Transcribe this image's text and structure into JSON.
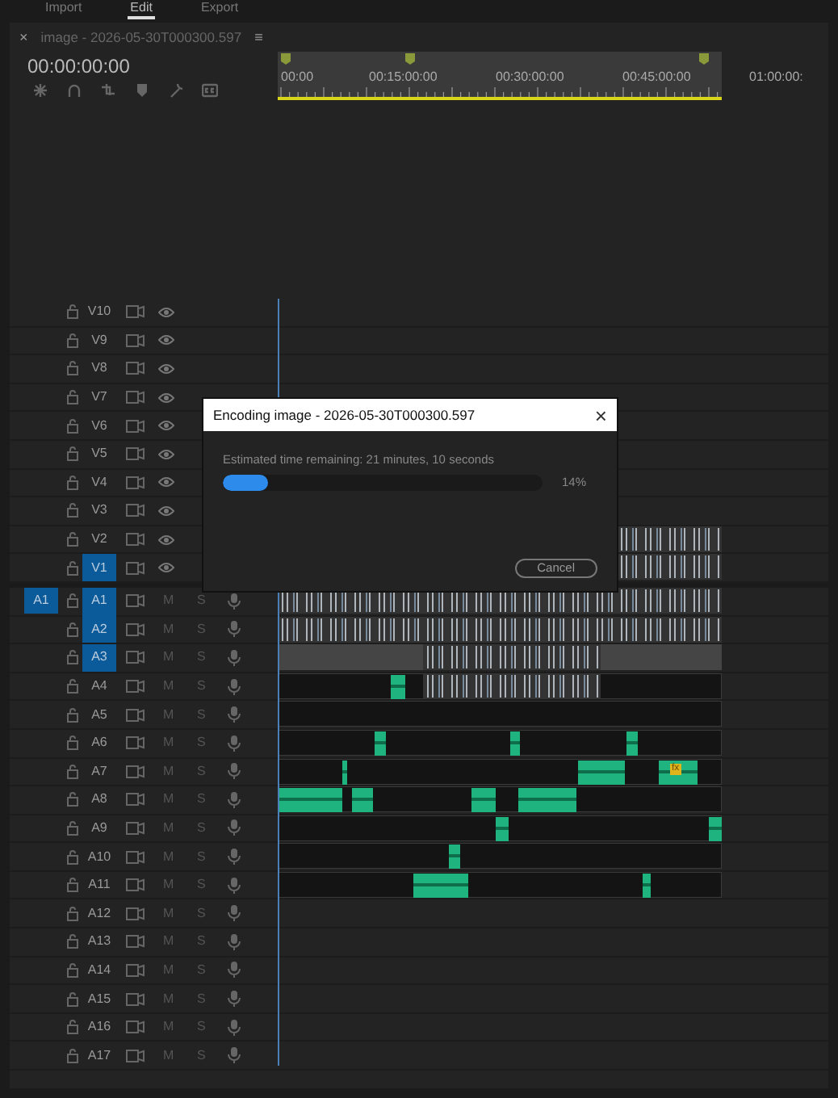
{
  "workspace_tabs": [
    {
      "label": "Import",
      "selected": false
    },
    {
      "label": "Edit",
      "selected": true
    },
    {
      "label": "Export",
      "selected": false
    }
  ],
  "panel": {
    "close": "×",
    "title": "image - 2026-05-30T000300.597",
    "menu": "≡"
  },
  "timecode": "00:00:00:00",
  "ruler": {
    "labels": [
      "00:00",
      "00:15:00:00",
      "00:30:00:00",
      "00:45:00:00",
      "01:00:00:"
    ]
  },
  "video_tracks": [
    {
      "name": "V10",
      "targeted": false
    },
    {
      "name": "V9",
      "targeted": false
    },
    {
      "name": "V8",
      "targeted": false
    },
    {
      "name": "V7",
      "targeted": false
    },
    {
      "name": "V6",
      "targeted": false
    },
    {
      "name": "V5",
      "targeted": false
    },
    {
      "name": "V4",
      "targeted": false
    },
    {
      "name": "V3",
      "targeted": false
    },
    {
      "name": "V2",
      "targeted": false
    },
    {
      "name": "V1",
      "targeted": true
    }
  ],
  "audio_tracks": [
    {
      "source_patch": "A1",
      "name": "A1",
      "targeted": true,
      "mute": "M",
      "solo": "S"
    },
    {
      "name": "A2",
      "targeted": true,
      "mute": "M",
      "solo": "S"
    },
    {
      "name": "A3",
      "targeted": true,
      "mute": "M",
      "solo": "S"
    },
    {
      "name": "A4",
      "targeted": false,
      "mute": "M",
      "solo": "S"
    },
    {
      "name": "A5",
      "targeted": false,
      "mute": "M",
      "solo": "S"
    },
    {
      "name": "A6",
      "targeted": false,
      "mute": "M",
      "solo": "S"
    },
    {
      "name": "A7",
      "targeted": false,
      "mute": "M",
      "solo": "S",
      "clip_badge": "fx"
    },
    {
      "name": "A8",
      "targeted": false,
      "mute": "M",
      "solo": "S"
    },
    {
      "name": "A9",
      "targeted": false,
      "mute": "M",
      "solo": "S"
    },
    {
      "name": "A10",
      "targeted": false,
      "mute": "M",
      "solo": "S"
    },
    {
      "name": "A11",
      "targeted": false,
      "mute": "M",
      "solo": "S"
    },
    {
      "name": "A12",
      "targeted": false,
      "mute": "M",
      "solo": "S"
    },
    {
      "name": "A13",
      "targeted": false,
      "mute": "M",
      "solo": "S"
    },
    {
      "name": "A14",
      "targeted": false,
      "mute": "M",
      "solo": "S"
    },
    {
      "name": "A15",
      "targeted": false,
      "mute": "M",
      "solo": "S"
    },
    {
      "name": "A16",
      "targeted": false,
      "mute": "M",
      "solo": "S"
    },
    {
      "name": "A17",
      "targeted": false,
      "mute": "M",
      "solo": "S"
    }
  ],
  "dialog": {
    "title": "Encoding image - 2026-05-30T000300.597",
    "close": "×",
    "status": "Estimated time remaining: 21 minutes, 10 seconds",
    "level": 0.14,
    "percent": "14%",
    "button": "Cancel"
  }
}
